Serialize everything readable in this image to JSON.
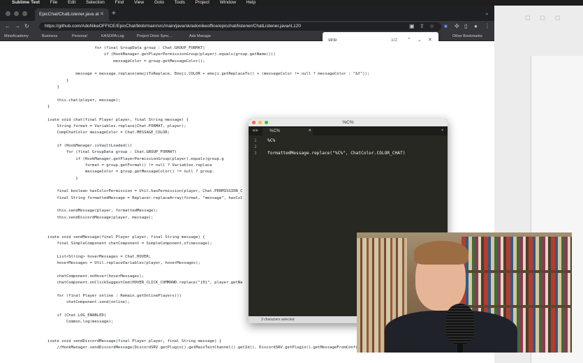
{
  "menubar": {
    "app_name": "Sublime Text",
    "items": [
      "File",
      "Edit",
      "Selection",
      "Find",
      "View",
      "Goto",
      "Tools",
      "Project",
      "Window",
      "Help"
    ]
  },
  "browser": {
    "tab_title": "EpicChat/ChatListener.java at",
    "url": "https://github.com/AdoNikeOFFICE/EpicChat/blob/main/src/main/java/sk/adonikeoffice/epicchat/listener/ChatListener.java#L120",
    "bookmarks": [
      "MineAcademy",
      "Business",
      "Personal",
      "KASOPA Log",
      "Project Orion Sync...",
      "Ads Manage"
    ],
    "bookmarks_right": "Other Bookmarks",
    "find": {
      "query": "strip",
      "count": "1/2"
    }
  },
  "code_lines": [
    "                    for (final GroupData group : Chat.GROUP_FORMAT)",
    "                        if (HookManager.getPlayerPermissionGroup(player).equals(group.getName()))",
    "                            messageColor = group.getMessageColor();",
    "",
    "            message = message.replace(emojiToReplace, Emoji.COLOR + emoji.getReplaceTo() + (messageColor != null ? messageColor : \"&f\"));",
    "        }",
    "    }",
    "",
    "    this.chat(player, message);",
    "}",
    "",
    "ivate void chat(final Player player, final String message) {",
    "    String format = Variables.replace(Chat.FORMAT, player);",
    "    CompChatColor messageColor = Chat.MESSAGE_COLOR;",
    "",
    "    if (HookManager.isVaultLoaded())",
    "        for (final GroupData group : Chat.GROUP_FORMAT)",
    "            if (HookManager.getPlayerPermissionGroup(player).equals(group.g",
    "                format = group.getFormat() != null ? Variables.replace",
    "                messageColor = group.getMessageColor() != null ? group.",
    "            }",
    "",
    "    final boolean hasColorPermission = Util.hasPermission(player, Chat.PERMISSION_C",
    "    final String formattedMessage = Replacer.replaceArray(format, \"message\", hasCol",
    "",
    "    this.sendMessage(player, formattedMessage);",
    "    this.sendDiscordMessage(player, message);",
    "",
    "",
    "ivate void sendMessage(final Player player, final String message) {",
    "    final SimpleComponent chatComponent = SimpleComponent.of(message);",
    "",
    "    List<String> hoverMessages = Chat.HOVER;",
    "    hoverMessages = Util.replaceVariables(player, hoverMessages);",
    "",
    "    chatComponent.onHover(hoverMessages);",
    "    chatComponent.onClickSuggestCmd(HOVER_CLICK_COMMAND.replace(\"{0}\", player.getNa",
    "",
    "    for (final Player online : Remain.getOnlinePlayers())",
    "        chatComponent.send(online);",
    "",
    "    if (Chat.LOG_ENABLED)",
    "        Common.log(message);",
    "",
    "",
    "ivate void sendDiscordMessage(final Player player, final String message) {",
    "    //HookManager.sendDiscordMessage(DiscordSRV.getPlugin().getMainTextChannel().getId(), DiscordSRV.getPlugin().getMessageFromConfiguration(\"\").getContent());"
  ],
  "sublime": {
    "window_title": "%C%",
    "tab_name": "%C%",
    "line_numbers": [
      "1",
      "2",
      "3"
    ],
    "lines": [
      "%C%",
      "",
      "formattedMessage.replace(\"%C%\", ChatColor.COLOR_CHAT)"
    ],
    "status": "3 characters selected"
  }
}
